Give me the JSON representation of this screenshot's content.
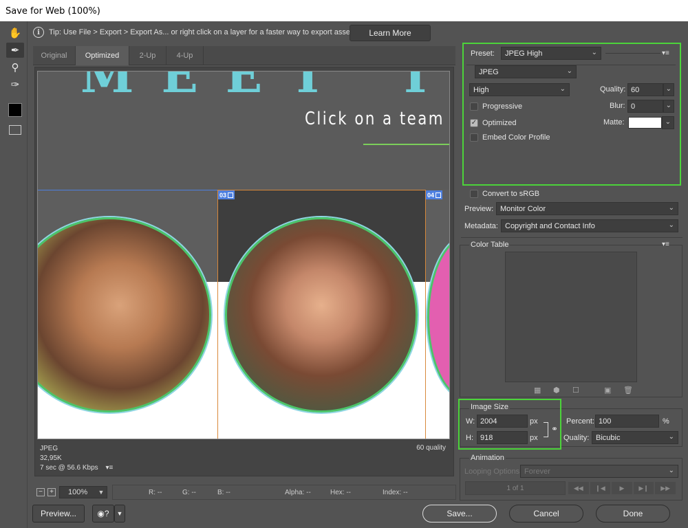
{
  "window": {
    "title": "Save for Web (100%)"
  },
  "tip": {
    "text": "Tip: Use File > Export > Export As...  or right click on a layer for a faster way to export assets",
    "learn_more": "Learn More"
  },
  "tabs": [
    {
      "label": "Original"
    },
    {
      "label": "Optimized",
      "active": true
    },
    {
      "label": "2-Up"
    },
    {
      "label": "4-Up"
    }
  ],
  "canvas": {
    "heading": "Click on a team m",
    "big_letters": "MEET T",
    "slice_tags": [
      "03",
      "04"
    ]
  },
  "preview_info": {
    "format": "JPEG",
    "size": "32,95K",
    "time": "7 sec @ 56.6 Kbps",
    "quality": "60 quality"
  },
  "status": {
    "zoom": "100%",
    "r": "R: --",
    "g": "G: --",
    "b": "B: --",
    "alpha": "Alpha: --",
    "hex": "Hex: --",
    "index": "Index: --"
  },
  "buttons": {
    "preview": "Preview...",
    "save": "Save...",
    "cancel": "Cancel",
    "done": "Done"
  },
  "settings": {
    "preset_label": "Preset:",
    "preset_value": "JPEG High",
    "format": "JPEG",
    "quality_level": "High",
    "quality_label": "Quality:",
    "quality_value": "60",
    "blur_label": "Blur:",
    "blur_value": "0",
    "matte_label": "Matte:",
    "progressive": "Progressive",
    "optimized": "Optimized",
    "embed_color": "Embed Color Profile",
    "convert_srgb": "Convert to sRGB",
    "preview_label": "Preview:",
    "preview_value": "Monitor Color",
    "metadata_label": "Metadata:",
    "metadata_value": "Copyright and Contact Info"
  },
  "color_table": {
    "title": "Color Table"
  },
  "image_size": {
    "title": "Image Size",
    "w_label": "W:",
    "w_value": "2004",
    "h_label": "H:",
    "h_value": "918",
    "unit": "px",
    "percent_label": "Percent:",
    "percent_value": "100",
    "percent_unit": "%",
    "quality_label": "Quality:",
    "quality_value": "Bicubic"
  },
  "animation": {
    "title": "Animation",
    "looping_label": "Looping Options:",
    "looping_value": "Forever",
    "frame": "1 of 1"
  },
  "colors": {
    "highlight_green": "#4cd43a",
    "accent_teal": "#6fcfd8",
    "slice_blue": "#4d7fe0",
    "slice_orange": "#d8883a"
  }
}
